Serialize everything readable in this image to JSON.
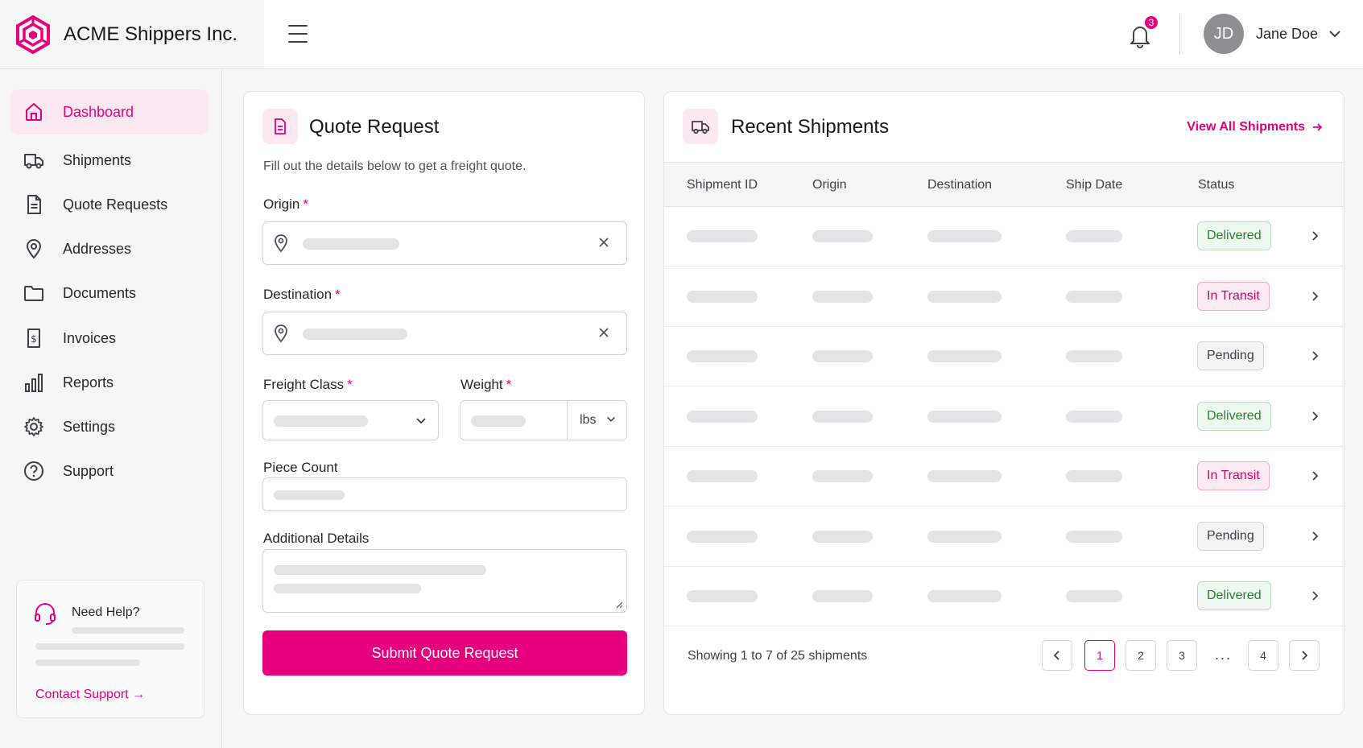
{
  "app": {
    "title": "ACME Shippers Inc.",
    "brand_color": "#e6007e"
  },
  "header": {
    "notification_count": "3",
    "user": {
      "initials": "JD",
      "name": "Jane Doe"
    }
  },
  "sidebar": {
    "items": [
      {
        "label": "Dashboard",
        "icon": "home-icon",
        "active": true
      },
      {
        "label": "Shipments",
        "icon": "truck-icon"
      },
      {
        "label": "Quote Requests",
        "icon": "document-icon"
      },
      {
        "label": "Addresses",
        "icon": "map-pin-icon"
      },
      {
        "label": "Documents",
        "icon": "folder-icon"
      },
      {
        "label": "Invoices",
        "icon": "receipt-icon"
      },
      {
        "label": "Reports",
        "icon": "bar-chart-icon"
      },
      {
        "label": "Settings",
        "icon": "gear-icon"
      },
      {
        "label": "Support",
        "icon": "help-circle-icon"
      }
    ],
    "help": {
      "title": "Need Help?",
      "link": "Contact Support"
    }
  },
  "quote": {
    "title": "Quote Request",
    "subtitle": "Fill out the details below to get a freight quote.",
    "origin_label": "Origin",
    "destination_label": "Destination",
    "freight_class_label": "Freight Class",
    "weight_label": "Weight",
    "weight_unit": "lbs",
    "piece_count_label": "Piece Count",
    "details_label": "Additional Details",
    "required_mark": "*",
    "submit_label": "Submit Quote Request"
  },
  "shipments": {
    "title": "Recent Shipments",
    "view_all": "View All Shipments",
    "columns": [
      "Shipment ID",
      "Origin",
      "Destination",
      "Ship Date",
      "Status"
    ],
    "rows": [
      {
        "status": "Delivered"
      },
      {
        "status": "In Transit"
      },
      {
        "status": "Pending"
      },
      {
        "status": "Delivered"
      },
      {
        "status": "In Transit"
      },
      {
        "status": "Pending"
      },
      {
        "status": "Delivered"
      }
    ],
    "footer": "Showing 1 to 7 of 25 shipments",
    "pages": [
      "1",
      "2",
      "3",
      "4"
    ],
    "ellipsis": "..."
  }
}
